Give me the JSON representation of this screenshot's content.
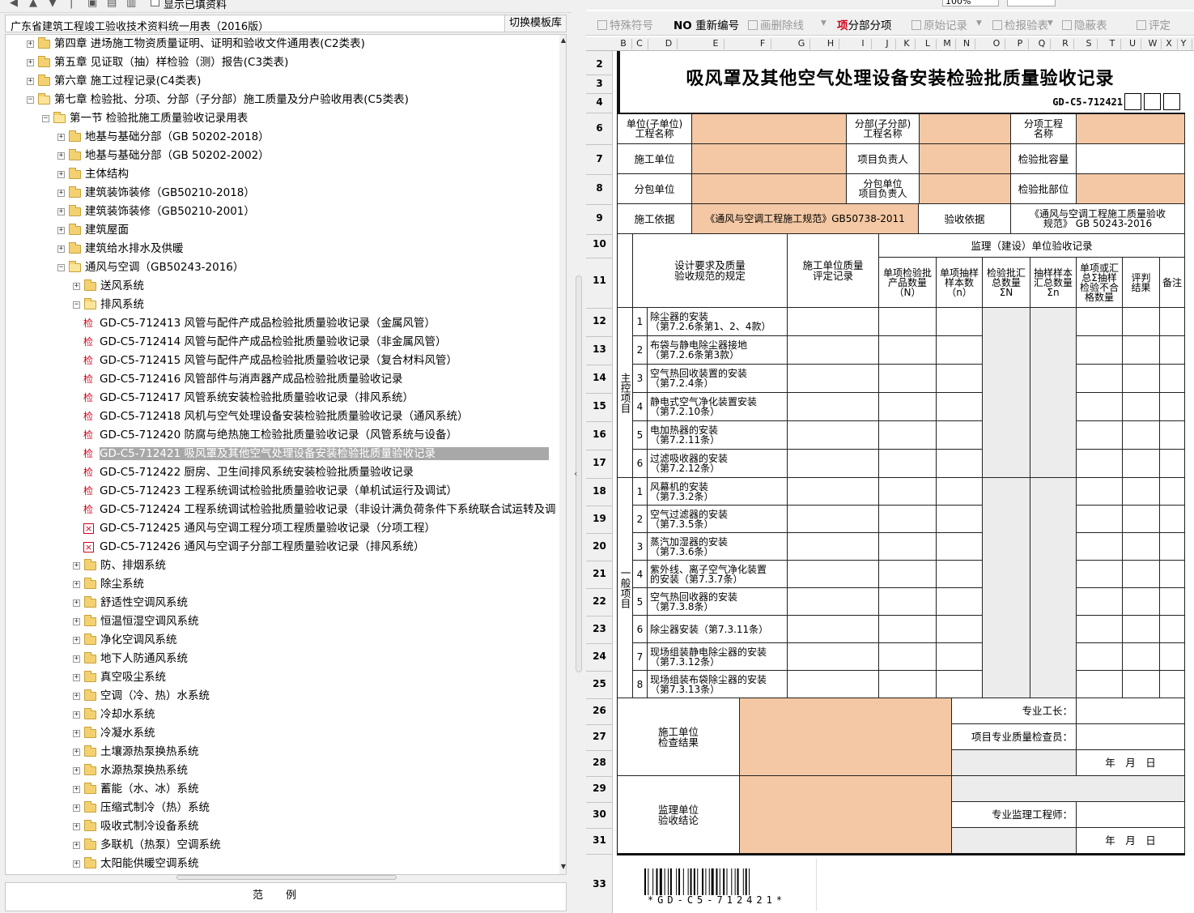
{
  "left_toolbar": {
    "show_filled_label": "显示已填资料"
  },
  "library": {
    "title": "广东省建筑工程竣工验收技术资料统一用表（2016版）",
    "switch_label": "切换模板库"
  },
  "tree": [
    {
      "level": 1,
      "kind": "folder",
      "exp": "+",
      "label": "第四章 进场施工物资质量证明、证明和验收文件通用表(C2类表)"
    },
    {
      "level": 1,
      "kind": "folder",
      "exp": "+",
      "label": "第五章 见证取（抽）样检验（测）报告(C3类表)"
    },
    {
      "level": 1,
      "kind": "folder",
      "exp": "+",
      "label": "第六章 施工过程记录(C4类表)"
    },
    {
      "level": 1,
      "kind": "folder-open",
      "exp": "−",
      "label": "第七章 检验批、分项、分部（子分部）施工质量及分户验收用表(C5类表)"
    },
    {
      "level": 2,
      "kind": "folder-open",
      "exp": "−",
      "label": "第一节 检验批施工质量验收记录用表"
    },
    {
      "level": 3,
      "kind": "folder",
      "exp": "+",
      "label": "地基与基础分部（GB 50202-2018）"
    },
    {
      "level": 3,
      "kind": "folder",
      "exp": "+",
      "label": "地基与基础分部（GB 50202-2002）"
    },
    {
      "level": 3,
      "kind": "folder",
      "exp": "+",
      "label": "主体结构"
    },
    {
      "level": 3,
      "kind": "folder",
      "exp": "+",
      "label": "建筑装饰装修（GB50210-2018）"
    },
    {
      "level": 3,
      "kind": "folder",
      "exp": "+",
      "label": "建筑装饰装修（GB50210-2001）"
    },
    {
      "level": 3,
      "kind": "folder",
      "exp": "+",
      "label": "建筑屋面"
    },
    {
      "level": 3,
      "kind": "folder",
      "exp": "+",
      "label": "建筑给水排水及供暖"
    },
    {
      "level": 3,
      "kind": "folder-open",
      "exp": "−",
      "label": "通风与空调（GB50243-2016）"
    },
    {
      "level": 4,
      "kind": "folder",
      "exp": "+",
      "label": "送风系统"
    },
    {
      "level": 4,
      "kind": "folder-open",
      "exp": "−",
      "label": "排风系统"
    },
    {
      "level": 5,
      "kind": "jian",
      "label": "GD-C5-712413 风管与配件产成品检验批质量验收记录（金属风管）"
    },
    {
      "level": 5,
      "kind": "jian",
      "label": "GD-C5-712414 风管与配件产成品检验批质量验收记录（非金属风管）"
    },
    {
      "level": 5,
      "kind": "jian",
      "label": "GD-C5-712415 风管与配件产成品检验批质量验收记录（复合材料风管）"
    },
    {
      "level": 5,
      "kind": "jian",
      "label": "GD-C5-712416 风管部件与消声器产成品检验批质量验收记录"
    },
    {
      "level": 5,
      "kind": "jian",
      "label": "GD-C5-712417 风管系统安装检验批质量验收记录（排风系统）"
    },
    {
      "level": 5,
      "kind": "jian",
      "label": "GD-C5-712418 风机与空气处理设备安装检验批质量验收记录（通风系统）"
    },
    {
      "level": 5,
      "kind": "jian",
      "label": "GD-C5-712420 防腐与绝热施工检验批质量验收记录（风管系统与设备）"
    },
    {
      "level": 5,
      "kind": "jian",
      "selected": true,
      "label": "GD-C5-712421 吸风罩及其他空气处理设备安装检验批质量验收记录"
    },
    {
      "level": 5,
      "kind": "jian",
      "label": "GD-C5-712422 厨房、卫生间排风系统安装检验批质量验收记录"
    },
    {
      "level": 5,
      "kind": "jian",
      "label": "GD-C5-712423 工程系统调试检验批质量验收记录（单机试运行及调试）"
    },
    {
      "level": 5,
      "kind": "jian",
      "label": "GD-C5-712424 工程系统调试检验批质量验收记录（非设计满负荷条件下系统联合试运转及调"
    },
    {
      "level": 5,
      "kind": "x",
      "label": "GD-C5-712425 通风与空调工程分项工程质量验收记录（分项工程）"
    },
    {
      "level": 5,
      "kind": "x",
      "label": "GD-C5-712426 通风与空调子分部工程质量验收记录（排风系统）"
    },
    {
      "level": 4,
      "kind": "folder",
      "exp": "+",
      "label": "防、排烟系统"
    },
    {
      "level": 4,
      "kind": "folder",
      "exp": "+",
      "label": "除尘系统"
    },
    {
      "level": 4,
      "kind": "folder",
      "exp": "+",
      "label": "舒适性空调风系统"
    },
    {
      "level": 4,
      "kind": "folder",
      "exp": "+",
      "label": "恒温恒湿空调风系统"
    },
    {
      "level": 4,
      "kind": "folder",
      "exp": "+",
      "label": "净化空调风系统"
    },
    {
      "level": 4,
      "kind": "folder",
      "exp": "+",
      "label": "地下人防通风系统"
    },
    {
      "level": 4,
      "kind": "folder",
      "exp": "+",
      "label": "真空吸尘系统"
    },
    {
      "level": 4,
      "kind": "folder",
      "exp": "+",
      "label": "空调（冷、热）水系统"
    },
    {
      "level": 4,
      "kind": "folder",
      "exp": "+",
      "label": "冷却水系统"
    },
    {
      "level": 4,
      "kind": "folder",
      "exp": "+",
      "label": "冷凝水系统"
    },
    {
      "level": 4,
      "kind": "folder",
      "exp": "+",
      "label": "土壤源热泵换热系统"
    },
    {
      "level": 4,
      "kind": "folder",
      "exp": "+",
      "label": "水源热泵换热系统"
    },
    {
      "level": 4,
      "kind": "folder",
      "exp": "+",
      "label": "蓄能（水、冰）系统"
    },
    {
      "level": 4,
      "kind": "folder",
      "exp": "+",
      "label": "压缩式制冷（热）系统"
    },
    {
      "level": 4,
      "kind": "folder",
      "exp": "+",
      "label": "吸收式制冷设备系统"
    },
    {
      "level": 4,
      "kind": "folder",
      "exp": "+",
      "label": "多联机（热泵）空调系统"
    },
    {
      "level": 4,
      "kind": "folder",
      "exp": "+",
      "label": "太阳能供暖空调系统"
    }
  ],
  "fanli_label": "范例",
  "right_toolbar": {
    "zoom": "100%",
    "items": [
      "特殊符号",
      "重新编号",
      "画删除线",
      "分部分项",
      "原始记录",
      "检报验表",
      "隐蔽表",
      "评定"
    ],
    "active_index": 3,
    "hi_mark": "项",
    "no_mark": "NO"
  },
  "columns": [
    "B",
    "C",
    "D",
    "E",
    "F",
    "G",
    "H",
    "I",
    "J",
    "K",
    "L",
    "M",
    "N",
    "O",
    "P",
    "Q",
    "R",
    "S",
    "T",
    "U",
    "W",
    "X",
    "Y"
  ],
  "rows": [
    "2",
    "3",
    "4",
    "6",
    "7",
    "8",
    "9",
    "10",
    "11",
    "12",
    "13",
    "14",
    "15",
    "16",
    "17",
    "18",
    "19",
    "20",
    "21",
    "22",
    "23",
    "24",
    "25",
    "26",
    "27",
    "28",
    "29",
    "30",
    "31",
    "33"
  ],
  "form": {
    "title": "吸风罩及其他空气处理设备安装检验批质量验收记录",
    "code": "GD-C5-712421",
    "unit_name": "单位(子单位)\n工程名称",
    "sub_name": "分部(子分部)\n工程名称",
    "item_name": "分项工程\n名称",
    "construct_unit": "施工单位",
    "project_manager": "项目负责人",
    "batch_capacity": "检验批容量",
    "subcontract_unit": "分包单位",
    "subcontract_manager": "分包单位\n项目负责人",
    "batch_location": "检验批部位",
    "construct_basis": "施工依据",
    "construct_basis_value": "《通风与空调工程施工规范》GB50738-2011",
    "accept_basis": "验收依据",
    "accept_basis_value": "《通风与空调工程施工质量验收\n规范》 GB 50243-2016",
    "supervision_header": "监理（建设）单位验收记录",
    "col_design": "设计要求及质量\n验收规范的规定",
    "col_construct_eval": "施工单位质量\n评定记录",
    "col_n": "单项检验批\n产品数量\n（N）",
    "col_sample": "单项抽样\n样本数\n（n）",
    "col_sum_n": "检验批汇\n总数量\nΣN",
    "col_sum_sample": "抽样样本\n汇总数量\nΣn",
    "col_fail": "单项或汇\n总Σ抽样\n检验不合\n格数量",
    "col_result": "评判\n结果",
    "col_remark": "备注",
    "main_label": "主控项目",
    "general_label": "一般项目",
    "main_items": [
      {
        "no": "1",
        "text": "除尘器的安装\n（第7.2.6条第1、2、4款）"
      },
      {
        "no": "2",
        "text": "布袋与静电除尘器接地\n（第7.2.6条第3款）"
      },
      {
        "no": "3",
        "text": "空气热回收装置的安装\n（第7.2.4条）"
      },
      {
        "no": "4",
        "text": "静电式空气净化装置安装\n（第7.2.10条）"
      },
      {
        "no": "5",
        "text": "电加热器的安装\n（第7.2.11条）"
      },
      {
        "no": "6",
        "text": "过滤吸收器的安装\n（第7.2.12条）"
      }
    ],
    "general_items": [
      {
        "no": "1",
        "text": "风幕机的安装\n（第7.3.2条）"
      },
      {
        "no": "2",
        "text": "空气过滤器的安装\n（第7.3.5条）"
      },
      {
        "no": "3",
        "text": "蒸汽加湿器的安装\n（第7.3.6条）"
      },
      {
        "no": "4",
        "text": "紫外线、离子空气净化装置\n的安装（第7.3.7条）"
      },
      {
        "no": "5",
        "text": "空气热回收器的安装\n（第7.3.8条）"
      },
      {
        "no": "6",
        "text": "除尘器安装（第7.3.11条）"
      },
      {
        "no": "7",
        "text": "现场组装静电除尘器的安装\n（第7.3.12条）"
      },
      {
        "no": "8",
        "text": "现场组装布袋除尘器的安装\n（第7.3.13条）"
      }
    ],
    "construct_check": "施工单位\n检查结果",
    "foreman": "专业工长：",
    "quality_inspector": "项目专业质量检查员：",
    "date_label": "年　月　日",
    "supervision_conclusion": "监理单位\n验收结论",
    "supervision_engineer": "专业监理工程师：",
    "barcode_text": "*GD-C5-712421*"
  },
  "colors": {
    "fill": "#f4c8a4",
    "selected": "#a8a8a8",
    "accent_red": "#d0021b"
  }
}
